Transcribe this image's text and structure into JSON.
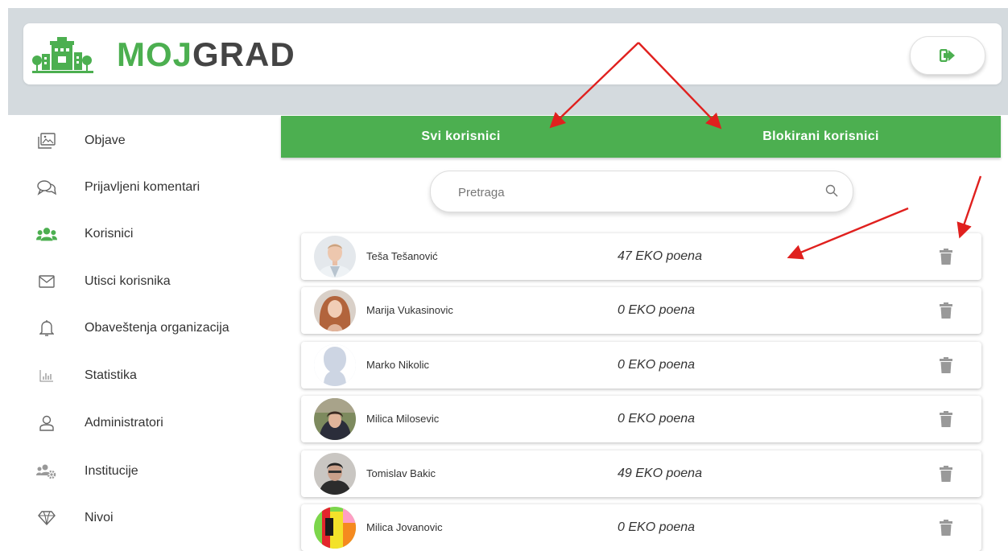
{
  "app": {
    "logo_moj": "MOJ",
    "logo_grad": "GRAD",
    "logout_icon": "sign-out-icon"
  },
  "sidebar": {
    "items": [
      {
        "label": "Objave",
        "icon": "image-icon"
      },
      {
        "label": "Prijavljeni komentari",
        "icon": "comments-icon"
      },
      {
        "label": "Korisnici",
        "icon": "users-icon",
        "active": true
      },
      {
        "label": "Utisci korisnika",
        "icon": "envelope-icon"
      },
      {
        "label": "Obaveštenja organizacija",
        "icon": "bell-icon"
      },
      {
        "label": "Statistika",
        "icon": "bar-chart-icon"
      },
      {
        "label": "Administratori",
        "icon": "user-icon"
      },
      {
        "label": "Institucije",
        "icon": "users-cog-icon"
      },
      {
        "label": "Nivoi",
        "icon": "diamond-icon"
      }
    ]
  },
  "tabs": [
    {
      "label": "Svi korisnici"
    },
    {
      "label": "Blokirani korisnici"
    }
  ],
  "search": {
    "placeholder": "Pretraga",
    "value": ""
  },
  "users": [
    {
      "name": "Teša Tešanović",
      "points": "47 EKO poena"
    },
    {
      "name": "Marija Vukasinovic",
      "points": "0 EKO poena"
    },
    {
      "name": "Marko Nikolic",
      "points": "0 EKO poena"
    },
    {
      "name": "Milica Milosevic",
      "points": "0 EKO poena"
    },
    {
      "name": "Tomislav Bakic",
      "points": "49 EKO poena"
    },
    {
      "name": "Milica Jovanovic",
      "points": "0 EKO poena"
    }
  ],
  "colors": {
    "brand_green": "#4caf50",
    "brand_dark": "#444444",
    "annotation_red": "#e0201e",
    "band_gray": "#d4dade"
  }
}
